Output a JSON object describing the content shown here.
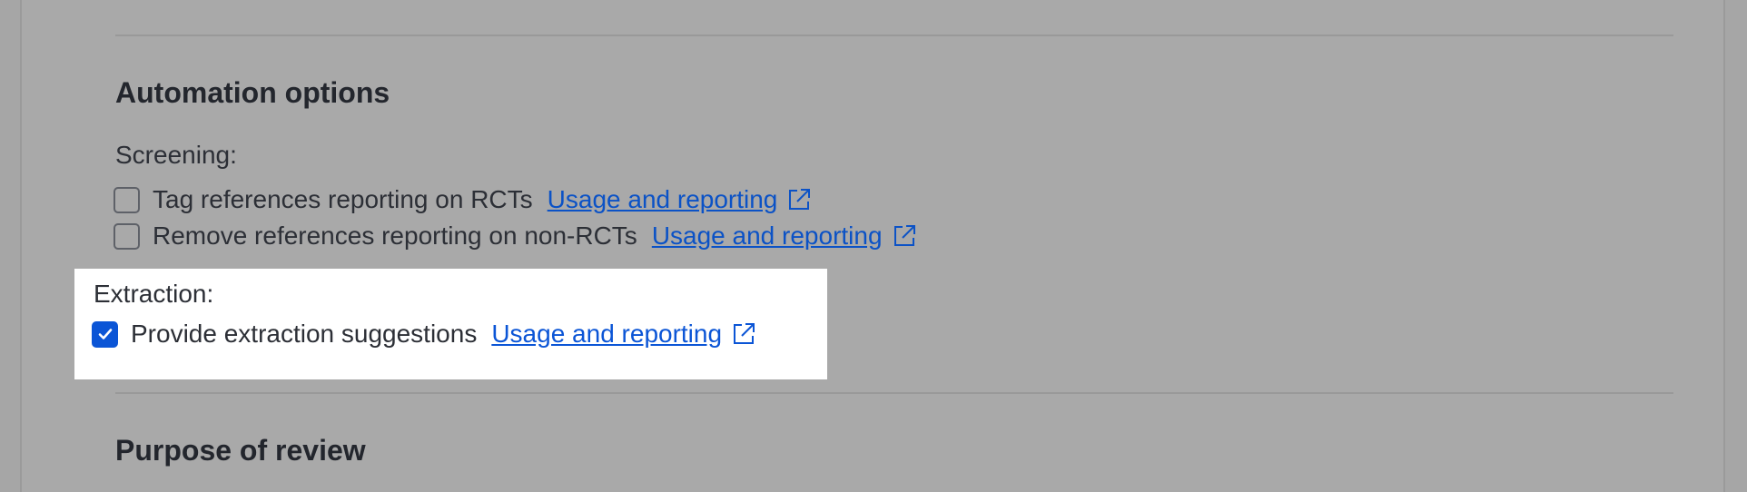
{
  "automation": {
    "heading": "Automation options",
    "screening": {
      "label": "Screening:",
      "options": [
        {
          "label": "Tag references reporting on RCTs",
          "checked": false,
          "link": "Usage and reporting"
        },
        {
          "label": "Remove references reporting on non-RCTs",
          "checked": false,
          "link": "Usage and reporting"
        }
      ]
    },
    "extraction": {
      "label": "Extraction:",
      "options": [
        {
          "label": "Provide extraction suggestions",
          "checked": true,
          "link": "Usage and reporting"
        }
      ]
    }
  },
  "purpose": {
    "heading": "Purpose of review"
  },
  "colors": {
    "accent": "#0b55d6",
    "link": "#0b52c6",
    "overlay": "#a6a6a6",
    "spotlight": "#ffffff"
  },
  "icons": {
    "external_link": "external-link-icon",
    "check": "check-icon"
  }
}
